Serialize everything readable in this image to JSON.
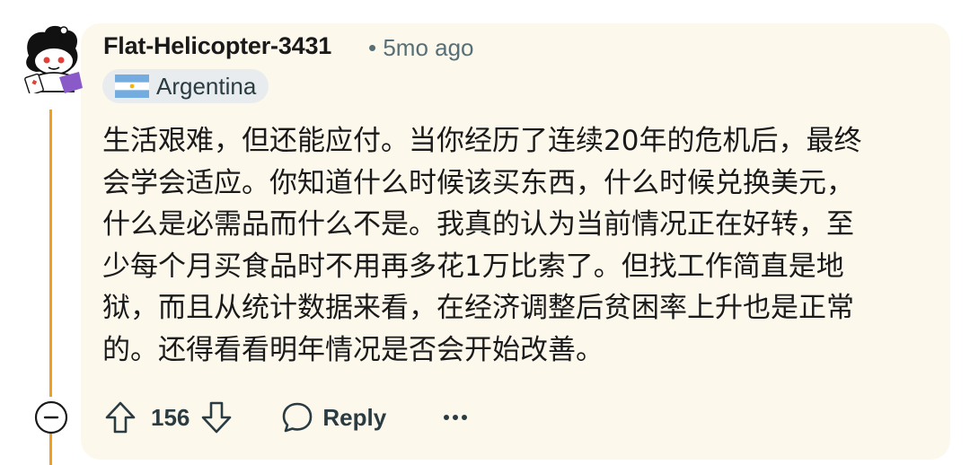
{
  "comment": {
    "username": "Flat-Helicopter-3431",
    "meta": "• 5mo ago",
    "flair": {
      "flag": "argentina-flag-icon",
      "text": "Argentina"
    },
    "body_lines": [
      "生活艰难，但还能应付。当你经历了连续20年的危机后，最终",
      "会学会适应。你知道什么时候该买东西，什么时候兑换美元，",
      "什么是必需品而什么不是。我真的认为当前情况正在好转，至",
      "少每个月买食品时不用再多花1万比索了。但找工作简直是地",
      "狱，而且从统计数据来看，在经济调整后贫困率上升也是正常",
      "的。还得看看明年情况是否会开始改善。"
    ],
    "score": "156",
    "reply_label": "Reply"
  },
  "colors": {
    "card_background": "#fcf8ec",
    "thread_line": "#f2a01b",
    "text": "#1a1a1b",
    "muted": "#576f76"
  }
}
